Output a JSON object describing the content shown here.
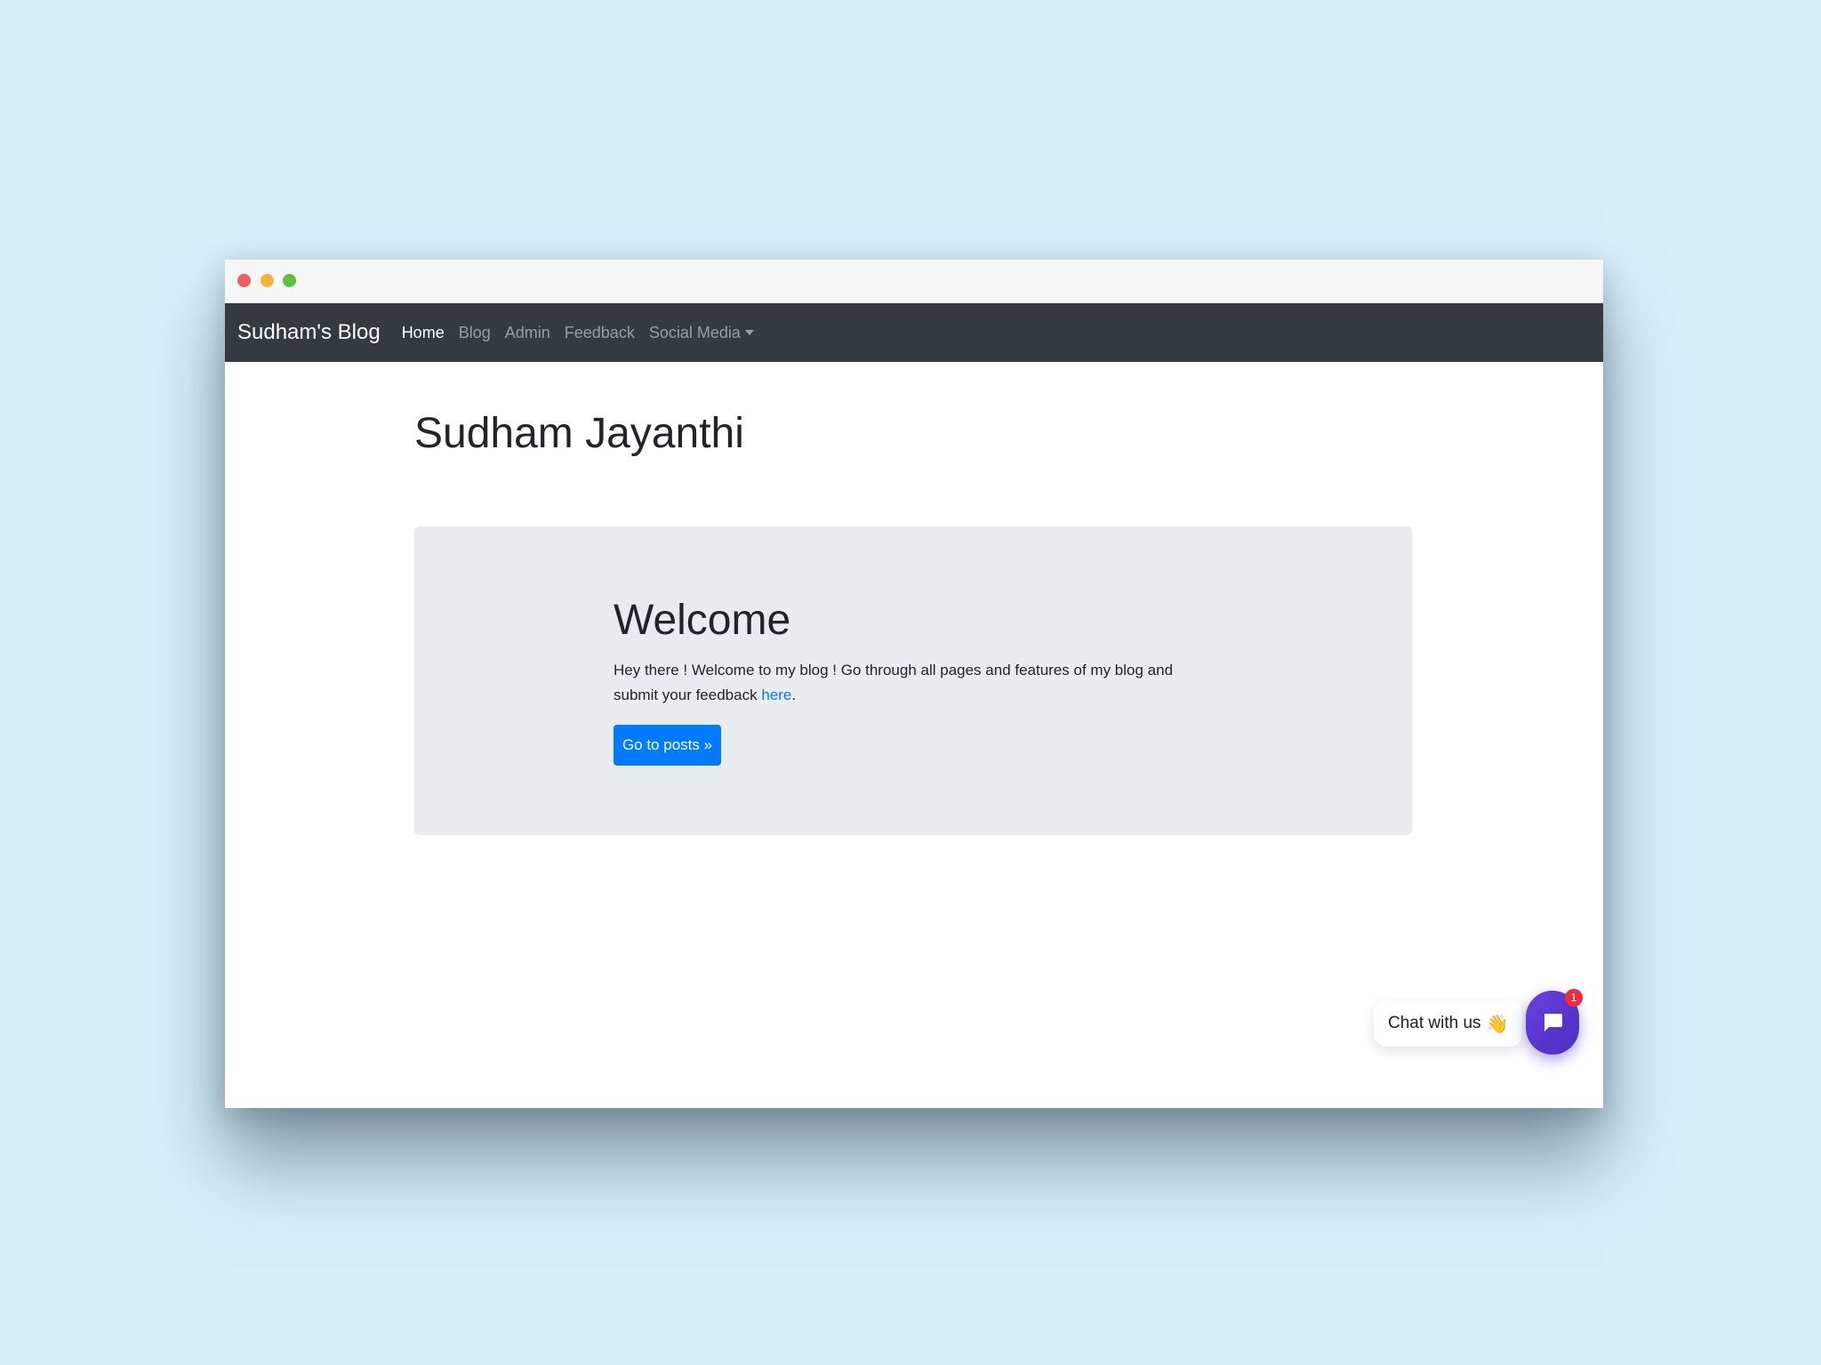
{
  "window": {
    "controls": [
      {
        "name": "close",
        "color": "#ec5f5a"
      },
      {
        "name": "minimize",
        "color": "#f4b33f"
      },
      {
        "name": "maximize",
        "color": "#5dc140"
      }
    ]
  },
  "navbar": {
    "brand": "Sudham's Blog",
    "items": [
      {
        "label": "Home",
        "active": true
      },
      {
        "label": "Blog",
        "active": false
      },
      {
        "label": "Admin",
        "active": false
      },
      {
        "label": "Feedback",
        "active": false
      },
      {
        "label": "Social Media",
        "active": false,
        "dropdown": true
      }
    ]
  },
  "main": {
    "title": "Sudham Jayanthi",
    "jumbotron": {
      "heading": "Welcome",
      "text_before_link": "Hey there ! Welcome to my blog ! Go through all pages and features of my blog and submit your feedback ",
      "link_label": "here",
      "text_after_link": ".",
      "button_label": "Go to posts »"
    }
  },
  "chat_widget": {
    "label": "Chat with us",
    "wave_icon": "👋",
    "launcher_icon": "chat-icon",
    "badge_count": "1",
    "colors": {
      "launcher": "#5a36d6",
      "badge": "#ef2b3c"
    }
  },
  "colors": {
    "page_background": "#d5effb",
    "navbar": "#343a40",
    "jumbotron": "#e9ecef",
    "primary": "#007bff"
  }
}
